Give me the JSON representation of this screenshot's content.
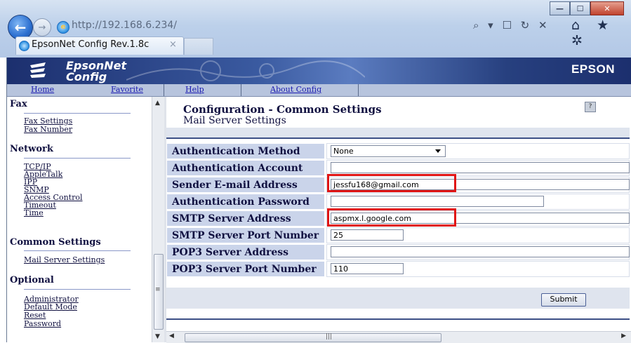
{
  "browser": {
    "url": "http://192.168.6.234/",
    "tab_title": "EpsonNet Config Rev.1.8c",
    "tab_close": "×",
    "address_tools": "⌕ ▾ ☐ ↻ ✕",
    "right_icons": "⌂ ★ ✲",
    "window_controls": {
      "minimize": "—",
      "maximize": "☐",
      "close": "✕"
    }
  },
  "banner": {
    "logo_line1": "EpsonNet",
    "logo_line2": "Config",
    "brand": "EPSON"
  },
  "nav": {
    "home": "Home",
    "favorite": "Favorite",
    "help": "Help",
    "about": "About Config"
  },
  "sidebar": {
    "sections": [
      {
        "heading": "Fax",
        "links": [
          "Fax Settings",
          "Fax Number"
        ]
      },
      {
        "heading": "Network",
        "links": [
          "TCP/IP",
          "AppleTalk",
          "IPP",
          "SNMP",
          "Access Control",
          "Timeout",
          "Time"
        ]
      },
      {
        "heading": "Common Settings",
        "links": [
          "Mail Server Settings"
        ]
      },
      {
        "heading": "Optional",
        "links": [
          "Administrator",
          "Default Mode",
          "Reset",
          "Password"
        ]
      }
    ]
  },
  "main": {
    "title": "Configuration - Common Settings",
    "subtitle": "Mail Server Settings",
    "help_icon": "?",
    "fields": [
      {
        "label": "Authentication Method",
        "type": "select",
        "value": "None"
      },
      {
        "label": "Authentication Account",
        "type": "text",
        "value": ""
      },
      {
        "label": "Sender E-mail Address",
        "type": "text",
        "value": "jessfu168@gmail.com"
      },
      {
        "label": "Authentication Password",
        "type": "text",
        "value": ""
      },
      {
        "label": "SMTP Server Address",
        "type": "text",
        "value": "aspmx.l.google.com"
      },
      {
        "label": "SMTP Server Port Number",
        "type": "text",
        "value": "25"
      },
      {
        "label": "POP3 Server Address",
        "type": "text",
        "value": ""
      },
      {
        "label": "POP3 Server Port Number",
        "type": "text",
        "value": "110"
      }
    ],
    "submit_label": "Submit"
  },
  "colors": {
    "highlight": "#e01515",
    "label_bg": "#cad4ea",
    "banner": "#1c2f6e"
  }
}
